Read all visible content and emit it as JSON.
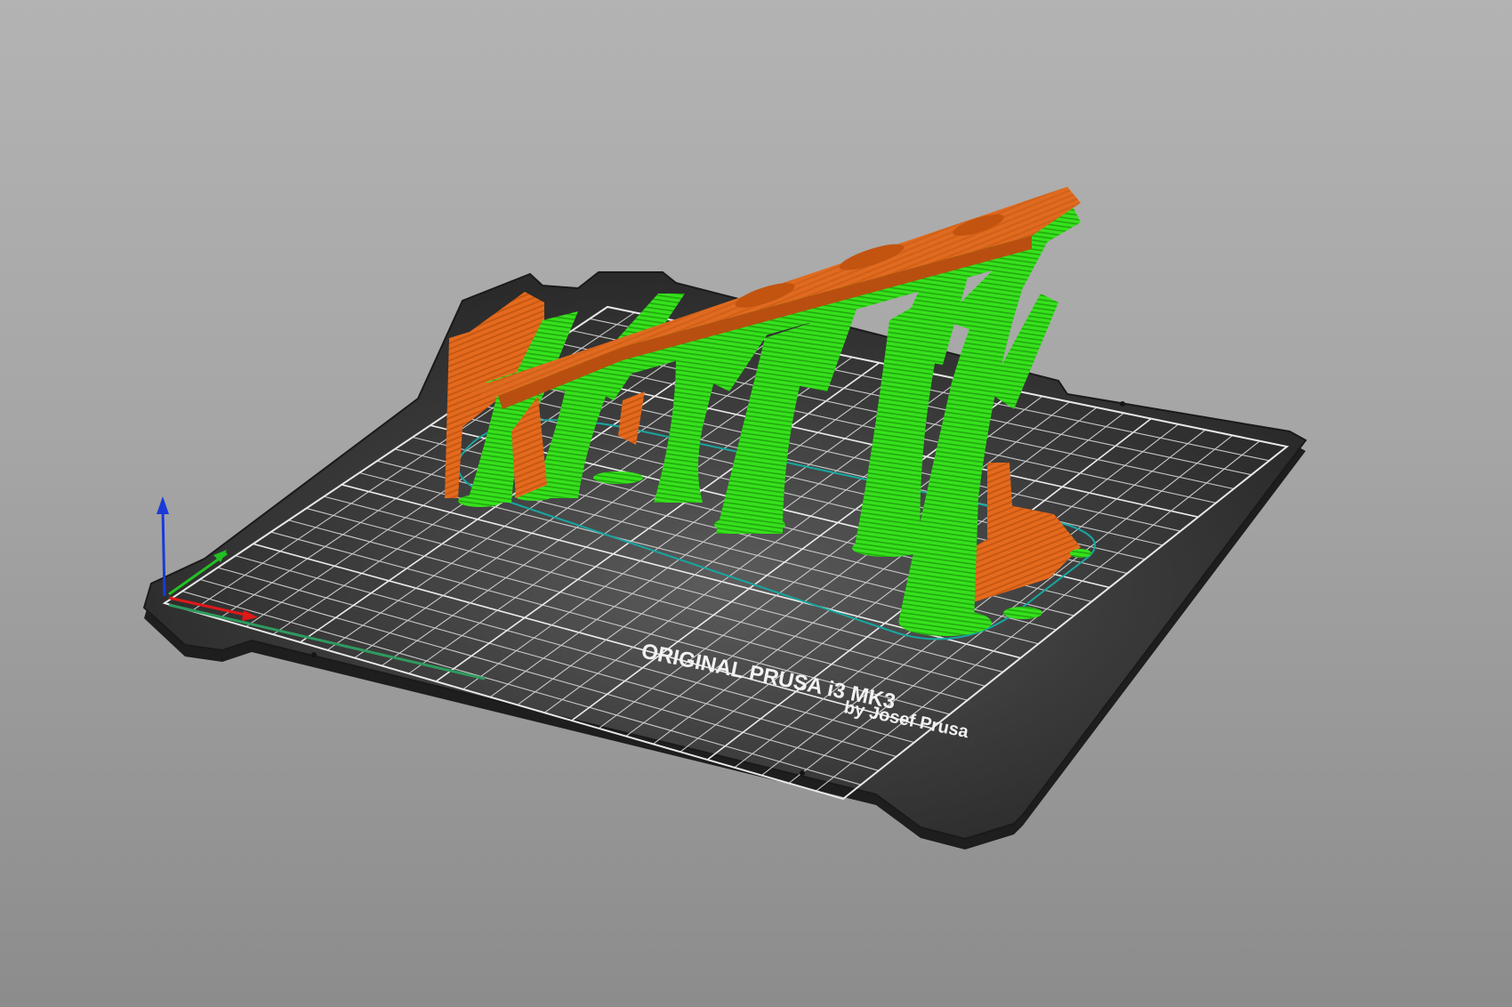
{
  "app": {
    "view": "3D preview"
  },
  "bed": {
    "title": "ORIGINAL PRUSA i3 MK3",
    "subtitle": "by Josef Prusa",
    "colors": {
      "plate": "#303030",
      "plate_edge": "#1e1e1e",
      "grid": "#bcbcbc",
      "grid_major": "#e6e6e6",
      "text": "#f2f2f2"
    }
  },
  "model": {
    "colors": {
      "print": "#e46a1e",
      "print_dark": "#b84f10",
      "support": "#33e019",
      "support_dark": "#1f9e0c",
      "skirt": "#18a6a0"
    }
  },
  "axes": {
    "icons": [
      "z-axis-icon",
      "y-axis-icon",
      "x-axis-icon"
    ],
    "colors": {
      "x": "#e01818",
      "y": "#22c022",
      "z": "#1a3ad8"
    }
  }
}
